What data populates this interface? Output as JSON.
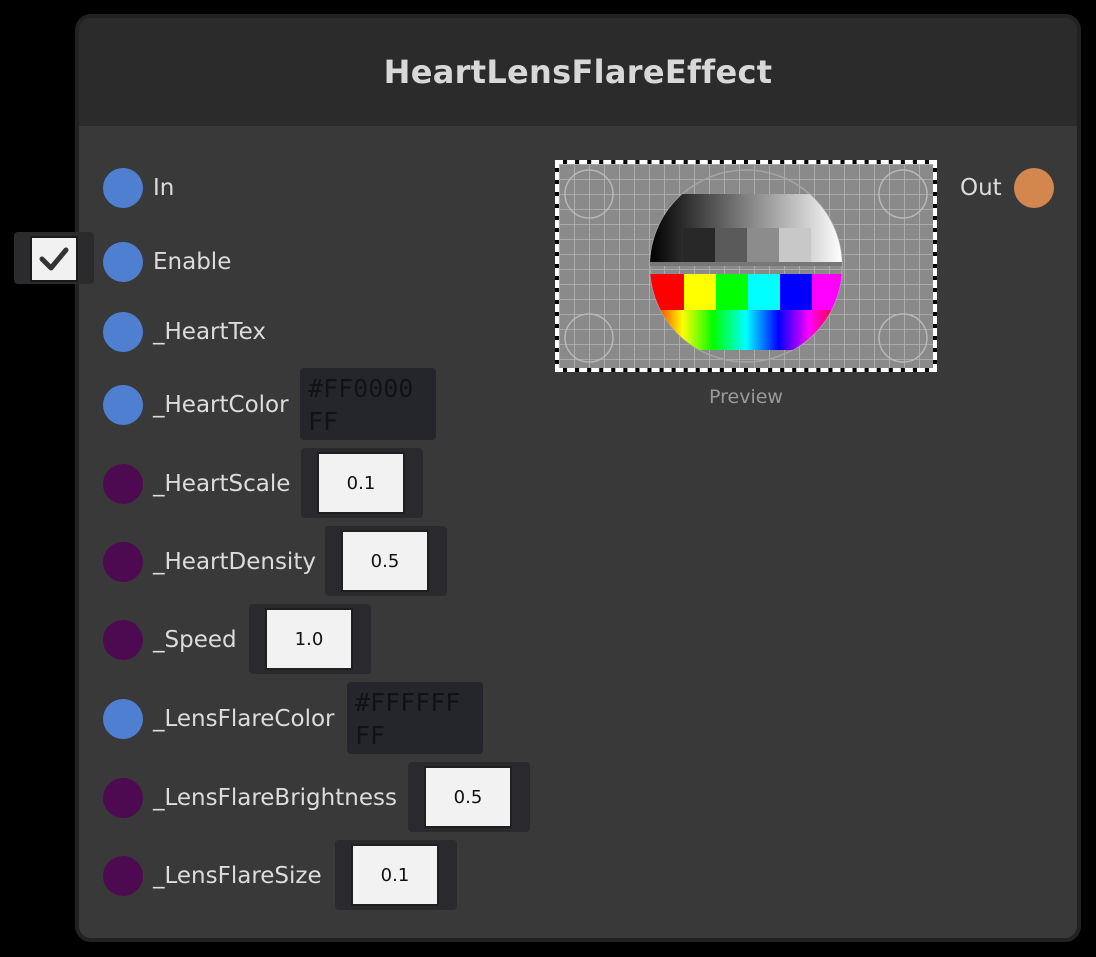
{
  "node": {
    "title": "HeartLensFlareEffect",
    "preview_label": "Preview",
    "enable_checked": true
  },
  "ports": {
    "in": "In",
    "enable": "Enable",
    "heart_tex": "_HeartTex",
    "heart_color": "_HeartColor",
    "heart_scale": "_HeartScale",
    "heart_density": "_HeartDensity",
    "speed": "_Speed",
    "lens_flare_color": "_LensFlareColor",
    "lens_flare_brightness": "_LensFlareBrightness",
    "lens_flare_size": "_LensFlareSize",
    "out": "Out"
  },
  "values": {
    "heart_color": "#FF0000FF",
    "heart_scale": "0.1",
    "heart_density": "0.5",
    "speed": "1.0",
    "lens_flare_color": "#FFFFFFFF",
    "lens_flare_brightness": "0.5",
    "lens_flare_size": "0.1"
  },
  "colors": {
    "input_port_blue": "#4f7fd1",
    "input_port_purple": "#4e0a50",
    "output_port_orange": "#d4864f"
  },
  "icons": {
    "enable_toggle": "checkmark-icon"
  }
}
